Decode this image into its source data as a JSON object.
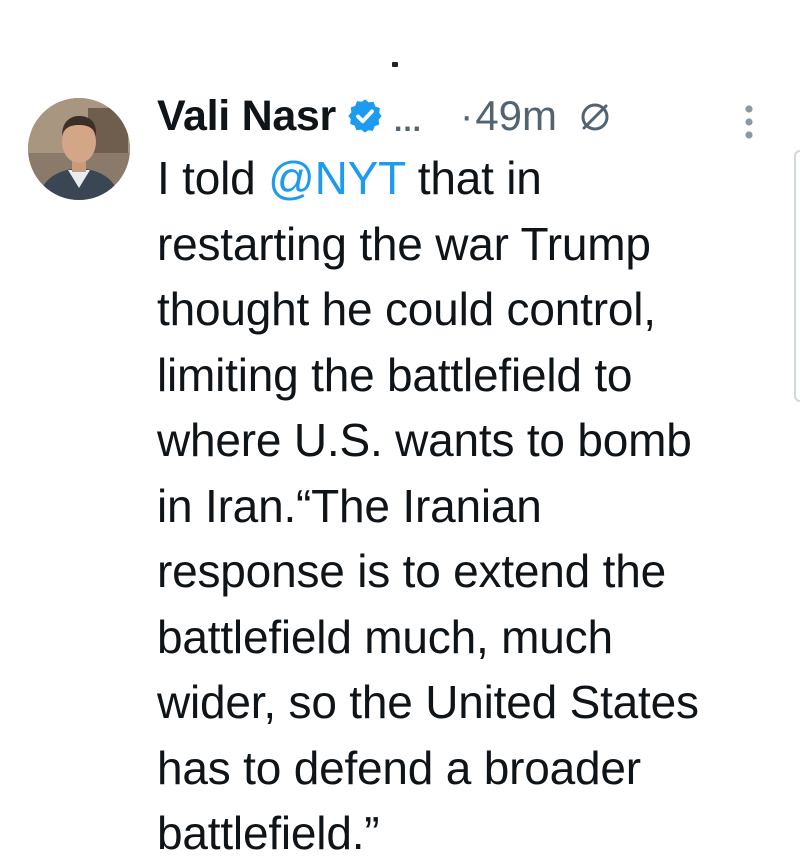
{
  "tweet": {
    "author_name": "Vali Nasr",
    "ellipsis": "...",
    "separator": "·",
    "time": "49m",
    "text_line1_before": "I told ",
    "mention": "@NYT",
    "text_line1_after": " that in",
    "text_rest": [
      "restarting the war Trump",
      "thought he could control,",
      "limiting the battlefield to",
      "where U.S. wants to bomb",
      "in Iran.“The Iranian",
      "response is to extend the",
      "battlefield much, much",
      "wider, so the United States",
      "has to defend a broader",
      "battlefield.”"
    ]
  },
  "icons": {
    "verified": "verified-badge-icon",
    "muted": "muted-icon",
    "more": "more-vertical-icon"
  },
  "colors": {
    "text": "#0f1419",
    "secondary": "#536471",
    "accent": "#1d9bf0"
  }
}
